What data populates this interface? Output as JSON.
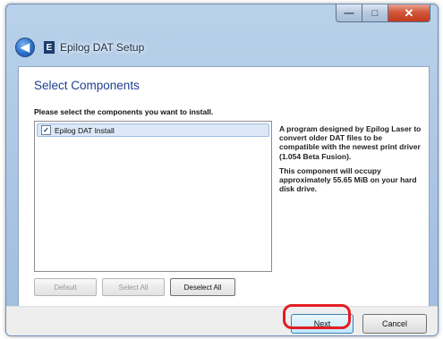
{
  "window": {
    "title": "Epilog DAT Setup",
    "app_icon_letter": "E",
    "back_glyph": "◀",
    "controls": {
      "minimize": "—",
      "maximize": "□",
      "close": "✕"
    }
  },
  "page": {
    "heading": "Select Components",
    "instruction": "Please select the components you want to install."
  },
  "components": [
    {
      "label": "Epilog DAT Install",
      "checked": true,
      "check_glyph": "✓"
    }
  ],
  "description": {
    "paragraphs": [
      "A program designed by Epilog Laser to convert older DAT files to be compatible with the newest print driver (1.054 Beta Fusion).",
      "This component will occupy approximately 55.65 MiB on your hard disk drive."
    ]
  },
  "selection_buttons": {
    "default": "Default",
    "select_all": "Select All",
    "deselect_all": "Deselect All"
  },
  "footer": {
    "next": "Next",
    "cancel": "Cancel"
  },
  "colors": {
    "heading": "#1e3f8e",
    "highlight": "#e31e24"
  }
}
